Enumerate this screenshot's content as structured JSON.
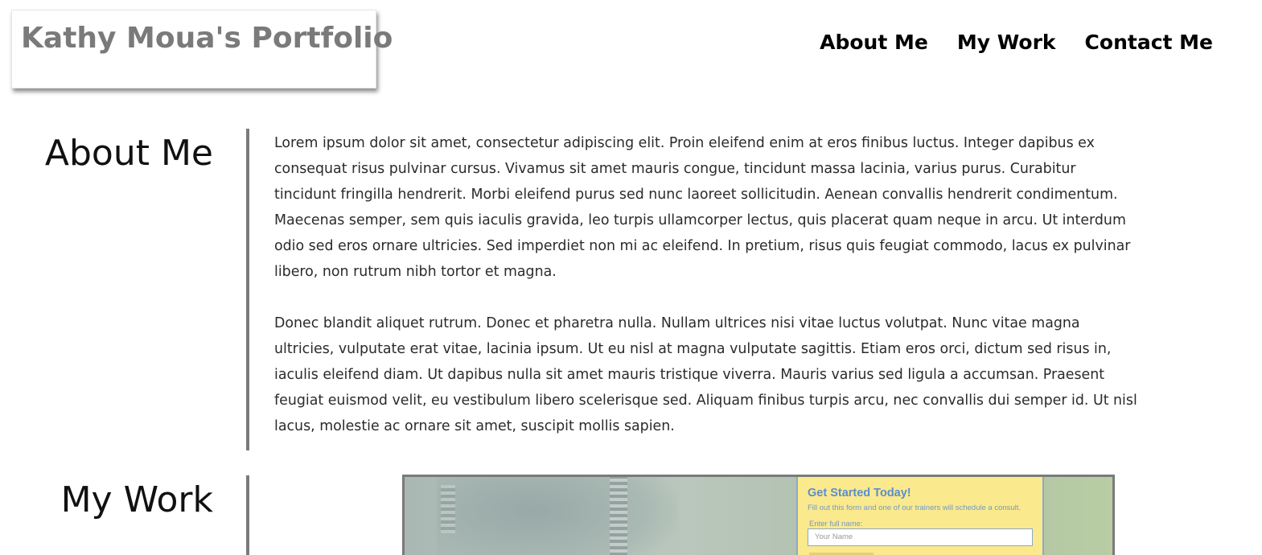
{
  "header": {
    "brand": "Kathy Moua's Portfolio",
    "nav": [
      {
        "label": "About Me"
      },
      {
        "label": "My Work"
      },
      {
        "label": "Contact Me"
      }
    ]
  },
  "about": {
    "title": "About Me",
    "paragraphs": [
      "Lorem ipsum dolor sit amet, consectetur adipiscing elit. Proin eleifend enim at eros finibus luctus. Integer dapibus ex consequat risus pulvinar cursus. Vivamus sit amet mauris congue, tincidunt massa lacinia, varius purus. Curabitur tincidunt fringilla hendrerit. Morbi eleifend purus sed nunc laoreet sollicitudin. Aenean convallis hendrerit condimentum. Maecenas semper, sem quis iaculis gravida, leo turpis ullamcorper lectus, quis placerat quam neque in arcu. Ut interdum odio sed eros ornare ultricies. Sed imperdiet non mi ac eleifend. In pretium, risus quis feugiat commodo, lacus ex pulvinar libero, non rutrum nibh tortor et magna.",
      "Donec blandit aliquet rutrum. Donec et pharetra nulla. Nullam ultrices nisi vitae luctus volutpat. Nunc vitae magna ultricies, vulputate erat vitae, lacinia ipsum. Ut eu nisl at magna vulputate sagittis. Etiam eros orci, dictum sed risus in, iaculis eleifend diam. Ut dapibus nulla sit amet mauris tristique viverra. Mauris varius sed ligula a accumsan. Praesent feugiat euismod velit, eu vestibulum libero scelerisque sed. Aliquam finibus turpis arcu, nec convallis dui semper id. Ut nisl lacus, molestie ac ornare sit amet, suscipit mollis sapien."
    ]
  },
  "work": {
    "title": "My Work",
    "project_screenshot": {
      "heading": "Get Started Today!",
      "subheading": "Fill out this form and one of our trainers will schedule a consult.",
      "field_label": "Enter full name:",
      "field_placeholder": "Your Name"
    }
  }
}
